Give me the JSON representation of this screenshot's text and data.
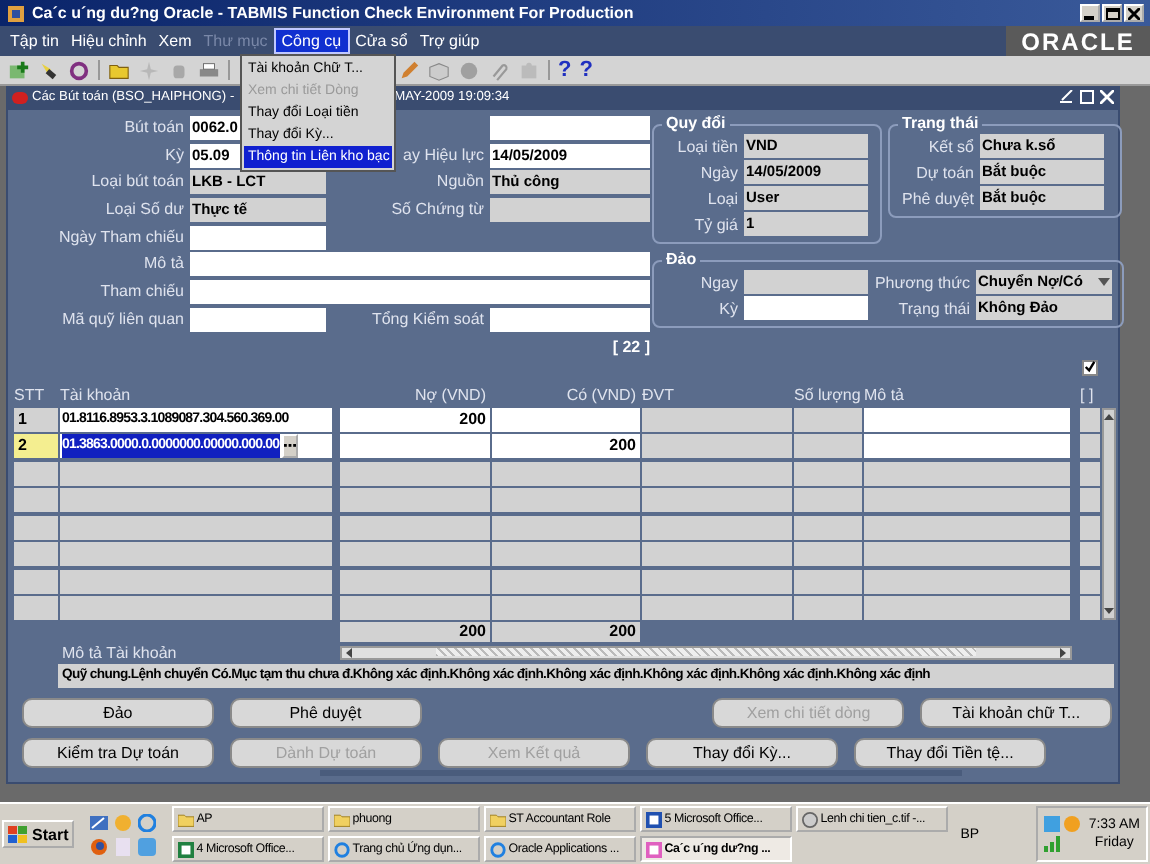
{
  "window": {
    "title": "Ca´c u´ng du?ng Oracle - TABMIS Function Check Environment For Production"
  },
  "menu": [
    {
      "label": "Tập tin",
      "disabled": false,
      "selected": false
    },
    {
      "label": "Hiệu chỉnh",
      "disabled": false,
      "selected": false
    },
    {
      "label": "Xem",
      "disabled": false,
      "selected": false
    },
    {
      "label": "Thư mục",
      "disabled": true,
      "selected": false
    },
    {
      "label": "Công cụ",
      "disabled": false,
      "selected": true
    },
    {
      "label": "Cửa sổ",
      "disabled": false,
      "selected": false
    },
    {
      "label": "Trợ giúp",
      "disabled": false,
      "selected": false
    }
  ],
  "logo": "ORACLE",
  "toolbar": {
    "help_glyphs": [
      "?",
      "?"
    ]
  },
  "dropdown": [
    {
      "label": "Tài khoản Chữ T...",
      "disabled": false,
      "selected": false
    },
    {
      "label": "Xem chi tiết Dòng",
      "disabled": true,
      "selected": false
    },
    {
      "label": "Thay đổi Loại tiền",
      "disabled": false,
      "selected": false
    },
    {
      "label": "Thay đổi Kỳ...",
      "disabled": false,
      "selected": false
    },
    {
      "label": "Thông tin Liên kho bạc",
      "disabled": false,
      "selected": true
    }
  ],
  "form_window": {
    "title_left": "Các Bút toán (BSO_HAIPHONG) -",
    "title_right": "MAY-2009 19:09:34"
  },
  "header_fields": {
    "but_toan": {
      "label": "Bút toán",
      "value": "0062.0"
    },
    "ky": {
      "label": "Kỳ",
      "value": "05.09"
    },
    "ngay_hieu_luc": {
      "label": "ay Hiệu lực",
      "value": "14/05/2009"
    },
    "loai_but_toan": {
      "label": "Loại bút toán",
      "value": "LKB - LCT"
    },
    "nguon": {
      "label": "Nguồn",
      "value": "Thủ công"
    },
    "loai_so_du": {
      "label": "Loại Số dư",
      "value": "Thực tế"
    },
    "so_chung_tu": {
      "label": "Số Chứng từ"
    },
    "ngay_tham_chieu": {
      "label": "Ngày Tham chiếu"
    },
    "mo_ta": {
      "label": "Mô tả"
    },
    "tham_chieu": {
      "label": "Tham chiếu"
    },
    "ma_quy": {
      "label": "Mã quỹ liên quan"
    },
    "tong_kiem_soat": {
      "label": "Tổng Kiểm soát"
    },
    "line_count": "[ 22 ]"
  },
  "quy_doi": {
    "title": "Quy đổi",
    "fields": [
      {
        "label": "Loại tiền",
        "value": "VND"
      },
      {
        "label": "Ngày",
        "value": "14/05/2009"
      },
      {
        "label": "Loại",
        "value": "User"
      },
      {
        "label": "Tỷ giá",
        "value": "1"
      }
    ]
  },
  "trang_thai": {
    "title": "Trạng thái",
    "fields": [
      {
        "label": "Kết sổ",
        "value": "Chưa k.sổ"
      },
      {
        "label": "Dự toán",
        "value": "Bắt buộc"
      },
      {
        "label": "Phê duyệt",
        "value": "Bắt buộc"
      }
    ]
  },
  "dao": {
    "title": "Đảo",
    "ngay_label": "Ngay",
    "ky_label": "Kỳ",
    "phuong_thuc_label": "Phương thức",
    "phuong_thuc_value": "Chuyển Nợ/Có",
    "trang_thai_label": "Trạng thái",
    "trang_thai_value": "Không Đảo"
  },
  "lines_checkbox": {
    "checked": true
  },
  "table": {
    "columns": [
      "STT",
      "Tài khoản",
      "Nợ (VND)",
      "Có (VND)",
      "ĐVT",
      "Số lượng",
      "Mô tả",
      "[ ]"
    ],
    "rows": [
      {
        "stt": "1",
        "account": "01.8116.8953.3.1089087.304.560.369.00",
        "debit": "200",
        "selected": false
      },
      {
        "stt": "2",
        "account": "01.3863.0000.0.0000000.00000.000.00",
        "credit": "200",
        "selected": true
      }
    ],
    "total_debit": "200",
    "total_credit": "200"
  },
  "account_description": {
    "label": "Mô tả Tài khoản",
    "value": "Quỹ chung.Lệnh chuyển Có.Mục tạm thu chưa đ.Không xác định.Không xác định.Không xác định.Không xác định.Không xác định.Không xác định"
  },
  "buttons": [
    [
      {
        "label": "Đảo",
        "disabled": false
      },
      {
        "label": "Phê duyệt",
        "disabled": false
      },
      {
        "kind": "spacer"
      },
      {
        "label": "Xem chi tiết dòng",
        "disabled": true
      },
      {
        "label": "Tài khoản chữ T...",
        "disabled": false
      }
    ],
    [
      {
        "label": "Kiểm tra Dự toán",
        "disabled": false
      },
      {
        "label": "Dành Dự toán",
        "disabled": true
      },
      {
        "label": "Xem Kết quả",
        "disabled": true
      },
      {
        "label": "Thay đổi Kỳ...",
        "disabled": false
      },
      {
        "label": "Thay đổi Tiền tệ...",
        "disabled": false
      }
    ]
  ],
  "taskbar": {
    "start": "Start",
    "tasks": [
      [
        {
          "label": "AP",
          "kind": "folder",
          "active": false
        },
        {
          "label": "phuong",
          "kind": "folder",
          "active": false
        },
        {
          "label": "ST Accountant Role",
          "kind": "folder",
          "active": false
        },
        {
          "label": "5 Microsoft Office...",
          "kind": "word",
          "active": false
        },
        {
          "label": "Lenh chi tien_c.tif -...",
          "kind": "image",
          "active": false
        }
      ],
      [
        {
          "label": "4 Microsoft Office...",
          "kind": "excel",
          "active": false
        },
        {
          "label": "Trang chủ Ứng dụn...",
          "kind": "browser",
          "active": false
        },
        {
          "label": "Oracle Applications ...",
          "kind": "browser",
          "active": false
        },
        {
          "label": "Ca´c u´ng dư?ng ...",
          "kind": "app",
          "active": true
        }
      ]
    ],
    "language": "BP",
    "time": "7:33 AM",
    "day": "Friday"
  }
}
